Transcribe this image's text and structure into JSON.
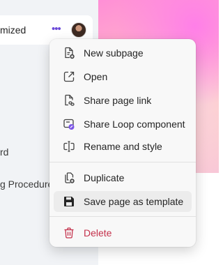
{
  "sidebar": {
    "page_title": "mized",
    "labels": [
      {
        "text": "rd"
      },
      {
        "text": "g Procedures"
      }
    ]
  },
  "context_menu": {
    "items": [
      {
        "label": "New subpage",
        "icon": "new-subpage-icon"
      },
      {
        "label": "Open",
        "icon": "open-external-icon"
      },
      {
        "label": "Share page link",
        "icon": "share-link-icon"
      },
      {
        "label": "Share Loop component",
        "icon": "loop-component-icon"
      },
      {
        "label": "Rename and style",
        "icon": "rename-icon"
      },
      {
        "label": "Duplicate",
        "icon": "duplicate-icon"
      },
      {
        "label": "Save page as template",
        "icon": "save-icon"
      },
      {
        "label": "Delete",
        "icon": "trash-icon"
      }
    ]
  },
  "colors": {
    "accent": "#6b49d8",
    "danger": "#c4314b",
    "menu_bg": "#f8f8f8",
    "hover_bg": "#ececec"
  }
}
